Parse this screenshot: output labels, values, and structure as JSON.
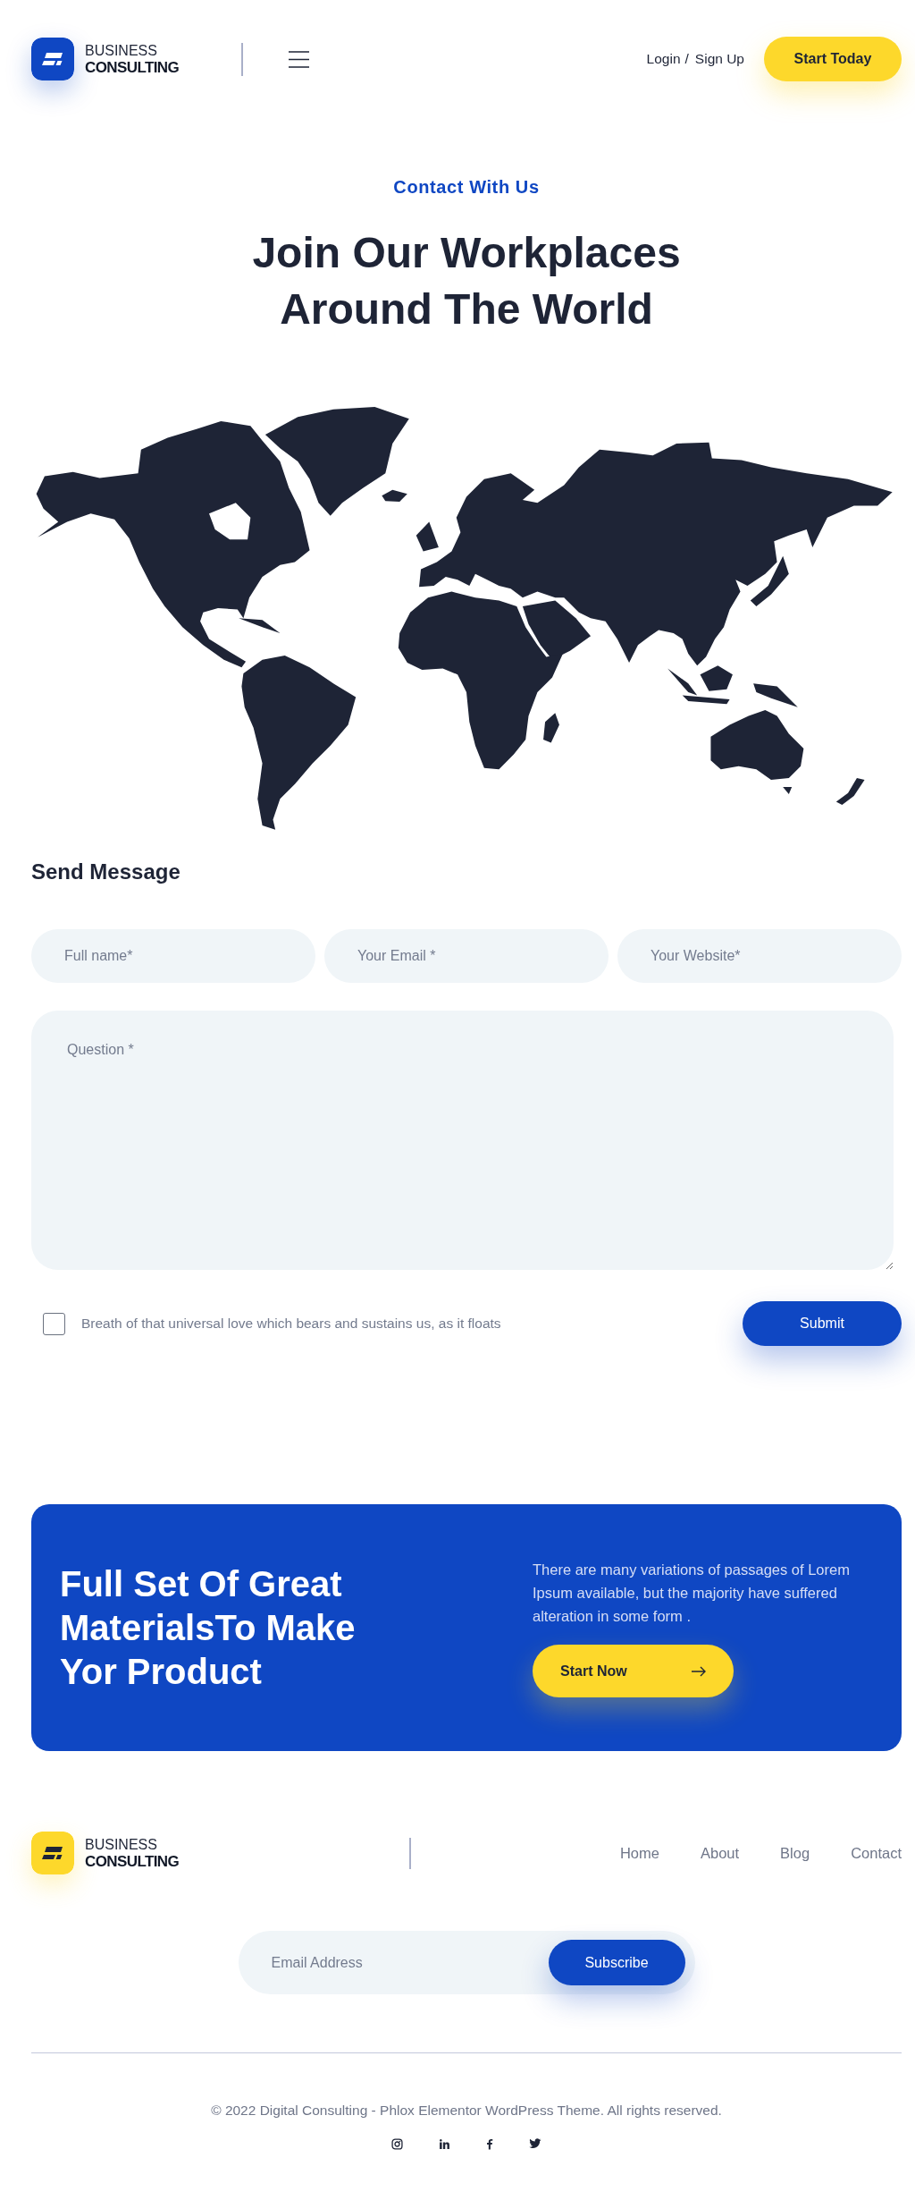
{
  "header": {
    "logo": {
      "line_1": "BUSINESS",
      "line_2": "CONSULTING"
    },
    "login_link": "Login",
    "separator": "/",
    "signup_link": "Sign Up",
    "cta_button": "Start Today"
  },
  "contact": {
    "eyebrow": "Contact With Us",
    "title": "Join Our Workplaces Around The World"
  },
  "form": {
    "title": "Send Message",
    "fields": [
      {
        "placeholder": "Full name*"
      },
      {
        "placeholder": "Your Email *"
      },
      {
        "placeholder": "Your Website*"
      }
    ],
    "message": {
      "placeholder": "Question *"
    },
    "consent": {
      "label": "Breath of that universal love which bears and sustains us, as it floats",
      "checked": false
    },
    "submit": "Submit"
  },
  "banner": {
    "title": "Full Set Of Great MaterialsTo Make Yor Product",
    "text": "There are many variations of passages of Lorem Ipsum available, but the majority have suffered alteration in some form .",
    "button": "Start Now"
  },
  "footer": {
    "logo": {
      "line_1": "BUSINESS",
      "line_2": "CONSULTING"
    },
    "nav": [
      {
        "label": "Home"
      },
      {
        "label": "About"
      },
      {
        "label": "Blog"
      },
      {
        "label": "Contact"
      }
    ],
    "newsletter": {
      "placeholder": "Email Address",
      "button": "Subscribe"
    },
    "copyright": "© 2022 Digital Consulting - Phlox Elementor WordPress Theme. All rights reserved.",
    "social": [
      {
        "kind": "instagram"
      },
      {
        "kind": "linkedin"
      },
      {
        "kind": "facebook"
      },
      {
        "kind": "twitter"
      }
    ]
  }
}
